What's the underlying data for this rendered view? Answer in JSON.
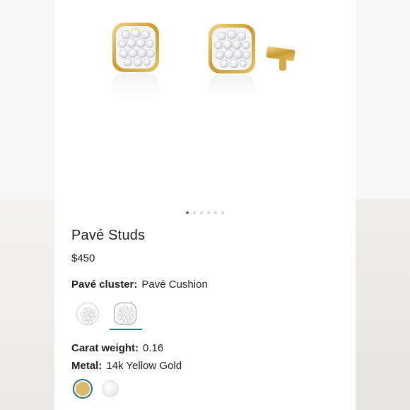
{
  "product": {
    "title": "Pavé Studs",
    "price": "$450"
  },
  "carousel": {
    "slide_count": 6,
    "active_index": 0
  },
  "options": {
    "cluster_label": "Pavé cluster:",
    "cluster_value": "Pavé Cushion",
    "cluster_choices": [
      "round-cluster",
      "cushion-cluster"
    ],
    "cluster_selected": 1,
    "carat_label": "Carat weight:",
    "carat_value": "0.16",
    "metal_label": "Metal:",
    "metal_value": "14k Yellow Gold",
    "metal_choices": [
      {
        "name": "yellow-gold",
        "color": "#d9b96b"
      },
      {
        "name": "white-gold",
        "color": "#efefef"
      }
    ],
    "metal_selected": 0
  },
  "colors": {
    "accent": "#2b6f75",
    "gold": "#d9b96b"
  }
}
